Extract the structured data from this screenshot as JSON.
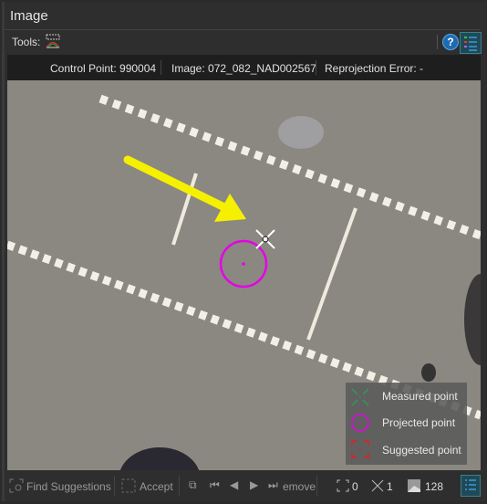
{
  "panel": {
    "title": "Image"
  },
  "toolbar": {
    "tools_label": "Tools:",
    "help_icon": "?"
  },
  "info": {
    "control_point": "Control Point: 990004",
    "image": "Image: 072_082_NAD002567",
    "reprojection_error": "Reprojection Error: -"
  },
  "legend": {
    "measured": "Measured point",
    "projected": "Projected point",
    "suggested": "Suggested point",
    "colors": {
      "measured": "#2e9a5a",
      "projected": "#e600e6",
      "suggested": "#e02020"
    }
  },
  "bottom": {
    "find_suggestions": "Find Suggestions",
    "accept": "Accept",
    "remove": "emove",
    "suggested_count": "0",
    "measured_count": "1",
    "contrast_value": "128"
  },
  "colors": {
    "arrow": "#f5f000",
    "accent": "#3b9ae1"
  }
}
